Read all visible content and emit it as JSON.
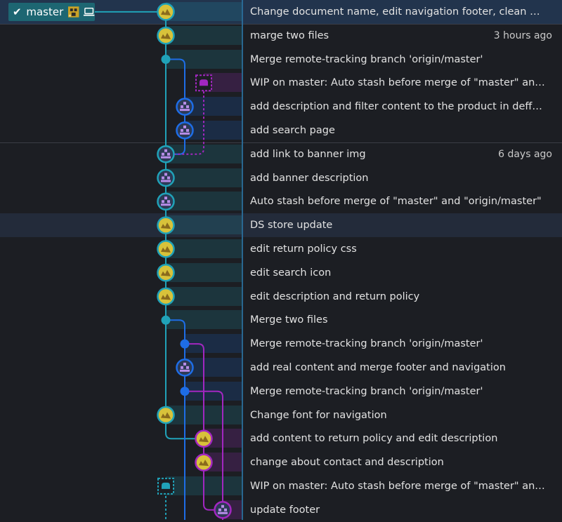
{
  "branch": {
    "name": "master",
    "check_icon": "checkmark-icon",
    "avatar_icon": "user-avatar-icon",
    "local_icon": "laptop-icon"
  },
  "colors": {
    "teal": "#20a2b8",
    "blue": "#1e6de6",
    "purple": "#a227c0",
    "selected_row": "#22344d",
    "background": "#1c1e23"
  },
  "commits": [
    {
      "message": "Change document name, edit navigation footer, clean file str...",
      "time": "",
      "lane": 0,
      "node": "avatar-gold",
      "lane_color": "teal"
    },
    {
      "message": "marge two files",
      "time": "3 hours ago",
      "lane": 0,
      "node": "avatar-gold",
      "lane_color": "teal"
    },
    {
      "message": "Merge remote-tracking branch 'origin/master'",
      "time": "",
      "lane": 0,
      "node": "merge-dot",
      "lane_color": "teal"
    },
    {
      "message": "WIP on master: Auto stash before merge of \"master\" and \"or...",
      "time": "",
      "lane": 2,
      "node": "stash",
      "lane_color": "purple"
    },
    {
      "message": "add description and filter content to the product in deffuser...",
      "time": "",
      "lane": 1,
      "node": "avatar-blue",
      "lane_color": "blue"
    },
    {
      "message": "add search page",
      "time": "",
      "lane": 1,
      "node": "avatar-blue",
      "lane_color": "blue"
    },
    {
      "message": "add link to banner img",
      "time": "6 days ago",
      "lane": 0,
      "node": "avatar-teal",
      "lane_color": "teal"
    },
    {
      "message": "add banner description",
      "time": "",
      "lane": 0,
      "node": "avatar-teal",
      "lane_color": "teal"
    },
    {
      "message": "Auto stash before merge of \"master\" and \"origin/master\"",
      "time": "",
      "lane": 0,
      "node": "avatar-teal",
      "lane_color": "teal"
    },
    {
      "message": "DS store update",
      "time": "",
      "lane": 0,
      "node": "avatar-gold",
      "lane_color": "teal"
    },
    {
      "message": "edit return policy css",
      "time": "",
      "lane": 0,
      "node": "avatar-gold",
      "lane_color": "teal"
    },
    {
      "message": "edit search icon",
      "time": "",
      "lane": 0,
      "node": "avatar-gold",
      "lane_color": "teal"
    },
    {
      "message": "edit description and return policy",
      "time": "",
      "lane": 0,
      "node": "avatar-gold",
      "lane_color": "teal"
    },
    {
      "message": "Merge two files",
      "time": "",
      "lane": 0,
      "node": "merge-dot",
      "lane_color": "teal"
    },
    {
      "message": "Merge remote-tracking branch 'origin/master'",
      "time": "",
      "lane": 1,
      "node": "merge-dot",
      "lane_color": "blue"
    },
    {
      "message": "add real content and merge footer and navigation",
      "time": "",
      "lane": 1,
      "node": "avatar-blue",
      "lane_color": "blue"
    },
    {
      "message": "Merge remote-tracking branch 'origin/master'",
      "time": "",
      "lane": 1,
      "node": "merge-dot",
      "lane_color": "blue"
    },
    {
      "message": "Change font for navigation",
      "time": "",
      "lane": 0,
      "node": "avatar-gold",
      "lane_color": "teal"
    },
    {
      "message": "add content to return policy and edit description",
      "time": "",
      "lane": 2,
      "node": "avatar-gold",
      "lane_color": "purple"
    },
    {
      "message": "change about contact and description",
      "time": "",
      "lane": 2,
      "node": "avatar-gold",
      "lane_color": "purple"
    },
    {
      "message": "WIP on master: Auto stash before merge of \"master\" and \"or...",
      "time": "",
      "lane": 0,
      "node": "stash",
      "lane_color": "teal"
    },
    {
      "message": "update footer",
      "time": "",
      "lane": 3,
      "node": "avatar-blue",
      "lane_color": "purple"
    }
  ]
}
